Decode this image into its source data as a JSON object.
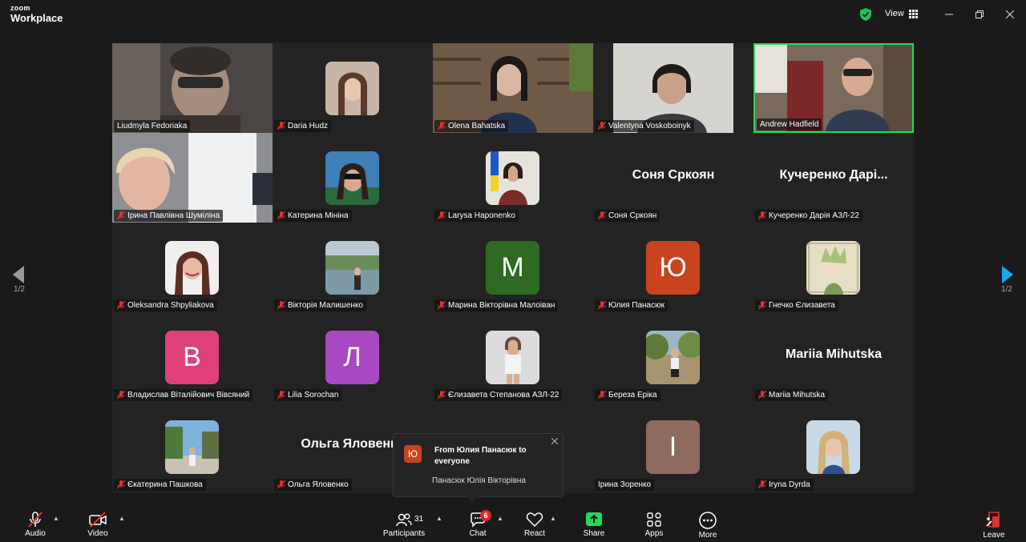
{
  "app": {
    "logo_top": "zoom",
    "logo_bottom": "Workplace",
    "view_label": "View"
  },
  "colors": {
    "accent_green": "#23d959",
    "secure_green": "#21c45b",
    "arrow_blue": "#1aa7ec",
    "badge_red": "#e02828"
  },
  "pager": {
    "left": "1/2",
    "right": "1/2"
  },
  "tiles": {
    "t1": {
      "name": "Liudmyla Fedoriaka"
    },
    "t2": {
      "name": "Daria Hudz"
    },
    "t3": {
      "name": "Olena Bahatska"
    },
    "t4": {
      "name": "Valentyna Voskoboinyk"
    },
    "t5": {
      "name": "Andrew Hadfield"
    },
    "t6": {
      "name": "Ірина Павлівна Шуміліна"
    },
    "t7": {
      "name": "Катерина Мініна"
    },
    "t8": {
      "name": "Larysa Haponenko"
    },
    "t9": {
      "big": "Соня Сркоян",
      "name": "Соня Сркоян"
    },
    "t10": {
      "big": "Кучеренко  Дарі...",
      "name": "Кучеренко Дарія АЗЛ-22"
    },
    "t11": {
      "name": "Oleksandra Shpyliakova"
    },
    "t12": {
      "name": "Вікторія Малишенко"
    },
    "t13": {
      "letter": "M",
      "name": "Марина  Вікторівна Малоіван"
    },
    "t14": {
      "letter": "Ю",
      "name": "Юлия Панасюк"
    },
    "t15": {
      "name": "Гнечко Єлизавета"
    },
    "t16": {
      "letter": "B",
      "name": "Владислав Віталійович Вівсяний"
    },
    "t17": {
      "letter": "Л",
      "name": "Lilia Sorochan"
    },
    "t18": {
      "name": "Єлизавета Степанова АЗЛ-22"
    },
    "t19": {
      "name": "Береза Еріка"
    },
    "t20": {
      "big": "Mariia Mihutska",
      "name": "Mariia Mihutska"
    },
    "t21": {
      "name": "Єкатерина Пашкова"
    },
    "t22": {
      "big": "Ольга Яловенко",
      "name": "Ольга Яловенко"
    },
    "t24": {
      "letter": "I",
      "name": "Ірина Зоренко"
    },
    "t25": {
      "name": "Iryna Dyrda"
    }
  },
  "toast": {
    "icon_letter": "Ю",
    "title": "From Юлия Панасюк to everyone",
    "body": "Панасюк Юлія Вікторівна"
  },
  "toolbar": {
    "audio": "Audio",
    "video": "Video",
    "participants": "Participants",
    "participants_count": "31",
    "chat": "Chat",
    "chat_badge": "6",
    "react": "React",
    "share": "Share",
    "apps": "Apps",
    "more": "More",
    "leave": "Leave"
  }
}
